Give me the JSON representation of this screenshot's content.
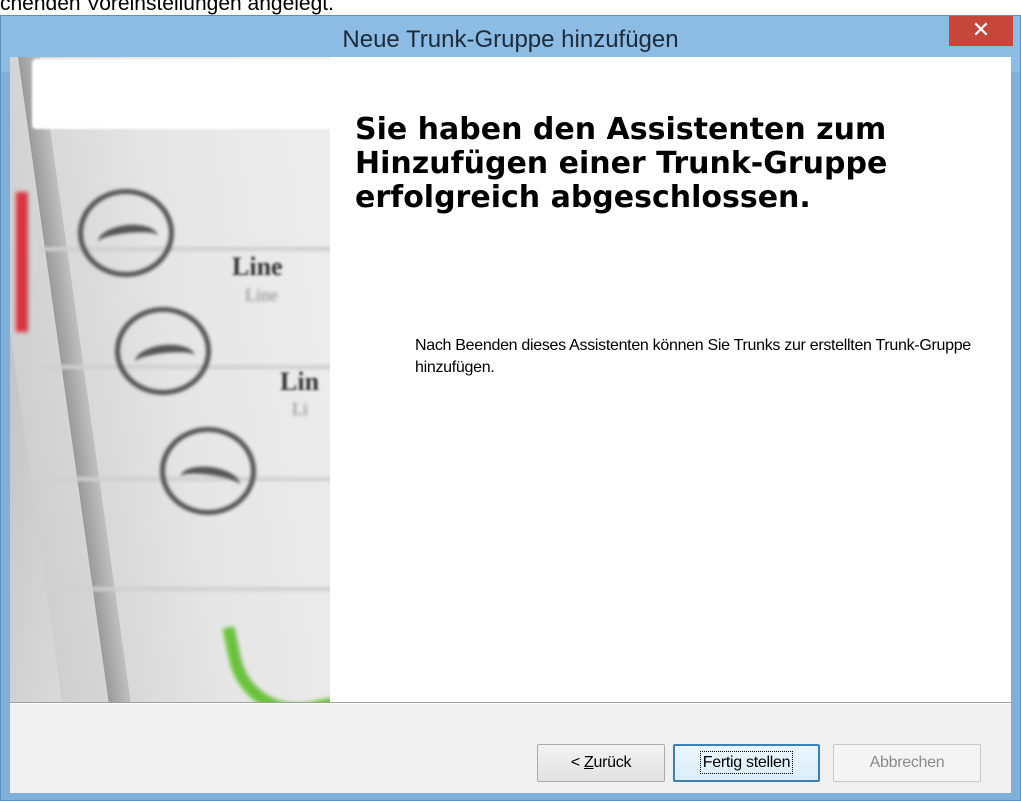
{
  "background": {
    "text": "chenden Voreinstellungen angelegt."
  },
  "window": {
    "title": "Neue Trunk-Gruppe hinzufügen",
    "close_glyph": "✕"
  },
  "side_image": {
    "line1_main": "Line",
    "line1_sub": "Line",
    "line2_main": "Lin",
    "line2_sub": "Li"
  },
  "main": {
    "heading": "Sie haben den Assistenten zum Hinzufügen einer Trunk-Gruppe erfolgreich abgeschlossen.",
    "body": "Nach Beenden dieses Assistenten können Sie Trunks zur erstellten Trunk-Gruppe hinzufügen."
  },
  "buttons": {
    "back_prefix": "< ",
    "back_accel": "Z",
    "back_rest": "urück",
    "finish": "Fertig stellen",
    "cancel": "Abbrechen"
  },
  "colors": {
    "titlebar": "#8cbbe3",
    "close": "#c7463a",
    "accent_green": "#6ac23c",
    "accent_red": "#d9343f"
  }
}
